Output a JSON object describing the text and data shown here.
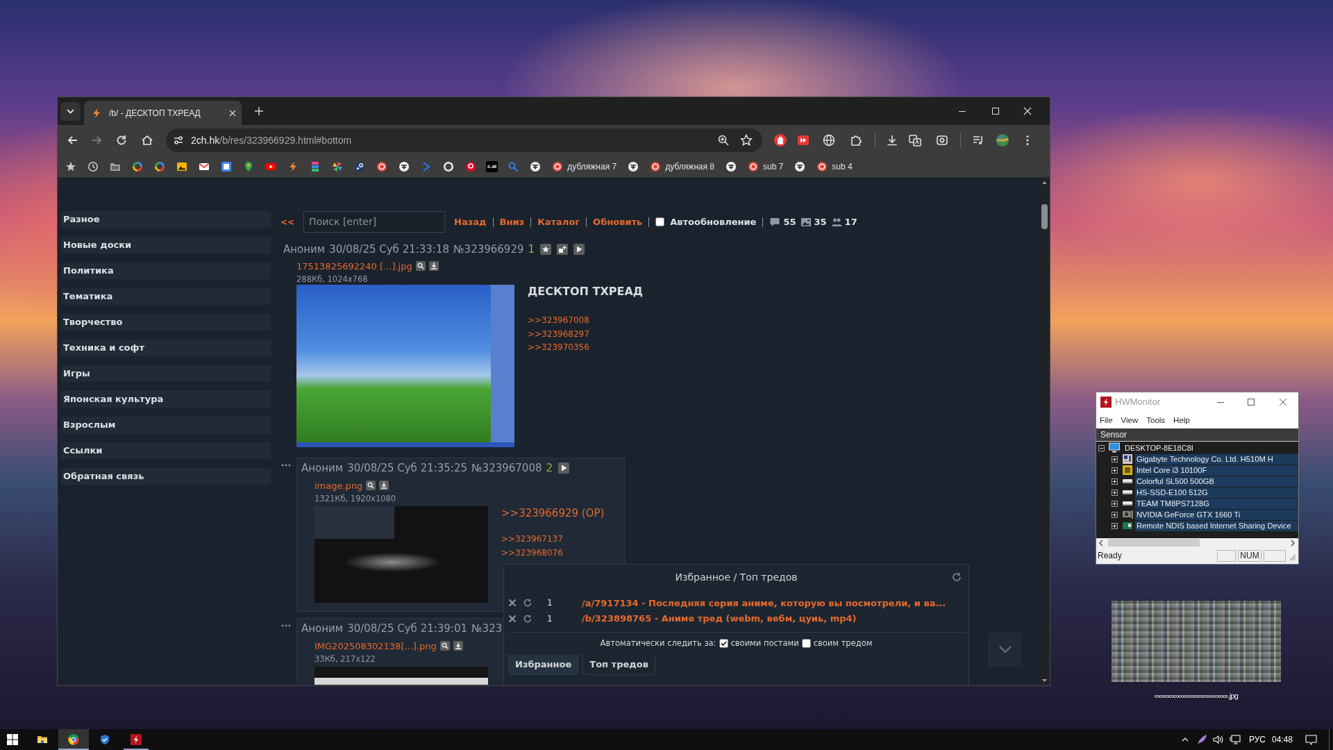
{
  "browser": {
    "tabs": [
      {
        "title": "/b/ - ДЕСКТОП ТХРЕАД",
        "selected": true
      }
    ],
    "forward": {
      "disabled": true
    },
    "url": {
      "host": "2ch.hk",
      "path": "/b/res/323966929.html#bottom"
    },
    "bookmarks": [
      {
        "kind": "tile",
        "label": "c.ai"
      },
      {
        "kind": "text",
        "label": "дубляжная 7"
      },
      {
        "kind": "text",
        "label": "дубляжная 8"
      },
      {
        "kind": "text",
        "label": "sub 7"
      },
      {
        "kind": "text",
        "label": "sub 4"
      }
    ]
  },
  "sidebar": {
    "items": [
      "Разное",
      "Новые доски",
      "Политика",
      "Тематика",
      "Творчество",
      "Техника и софт",
      "Игры",
      "Японская культура",
      "Взрослым",
      "Ссылки",
      "Обратная связь"
    ]
  },
  "thread_nav": {
    "back": "<<",
    "search": {
      "placeholder": "Поиск [enter]"
    },
    "links": [
      "Назад",
      "Вниз",
      "Каталог",
      "Обновить"
    ],
    "autoupdate": {
      "label": "Автообновление",
      "checked": false
    },
    "stats": {
      "posts": "55",
      "images": "35",
      "posters": "17"
    }
  },
  "posts": [
    {
      "kind": "op",
      "name": "Аноним",
      "date": "30/08/25 Суб 21:33:18",
      "number": "№323966929",
      "count": "1",
      "file": {
        "name": "17513825692240 [...].jpg",
        "info": "288Кб, 1024x768"
      },
      "subject": "ДЕСКТОП ТХРЕАД",
      "backlinks": [
        ">>323967008",
        ">>323968297",
        ">>323970356"
      ]
    },
    {
      "kind": "reply",
      "name": "Аноним",
      "date": "30/08/25 Суб 21:35:25",
      "number": "№323967008",
      "count": "2",
      "file": {
        "name": "image.png",
        "info": "1321Кб, 1920x1080"
      },
      "quote": ">>323966929 (OP)",
      "backlinks": [
        ">>323967137",
        ">>323968076"
      ]
    },
    {
      "kind": "reply",
      "name": "Аноним",
      "date": "30/08/25 Суб 21:39:01",
      "number": "№323",
      "file": {
        "name": "IMG202508302138[...].png",
        "info": "33Кб, 217x122"
      }
    }
  ],
  "favorites": {
    "title": "Избранное / Топ тредов",
    "threads": [
      {
        "count": "1",
        "link": "/a/7917134 - Последняя серия аниме, которую вы посмотрели, и ва..."
      },
      {
        "count": "1",
        "link": "/b/323898765 - Аниме тред (webm, вебм, цуиь, mp4)"
      }
    ],
    "autofollow": {
      "label": "Автоматически следить за:",
      "options": [
        {
          "label": "своими постами",
          "checked": true
        },
        {
          "label": "своим тредом",
          "checked": false
        }
      ]
    },
    "tabs": [
      {
        "label": "Избранное",
        "selected": true
      },
      {
        "label": "Топ тредов",
        "selected": false
      }
    ]
  },
  "hwmonitor": {
    "title": "HWMonitor",
    "menu": [
      "File",
      "View",
      "Tools",
      "Help"
    ],
    "column": "Sensor",
    "tree": [
      {
        "label": "DESKTOP-8E18C8I",
        "expanded": true,
        "selected": false,
        "children": [
          {
            "label": "Gigabyte Technology Co. Ltd. H510M H",
            "expanded": false,
            "selected": true
          },
          {
            "label": "Intel Core i3 10100F",
            "expanded": false,
            "selected": true
          },
          {
            "label": "Colorful SL500 500GB",
            "expanded": false,
            "selected": true
          },
          {
            "label": "HS-SSD-E100 512G",
            "expanded": false,
            "selected": true
          },
          {
            "label": "TEAM TM8PS7128G",
            "expanded": false,
            "selected": true
          },
          {
            "label": "NVIDIA GeForce GTX 1660 Ti",
            "expanded": false,
            "selected": true
          },
          {
            "label": "Remote NDIS based Internet Sharing Device",
            "expanded": false,
            "selected": true
          }
        ]
      }
    ],
    "status": "Ready",
    "indicator": "NUM"
  },
  "desktop_file": {
    "name": "∞∞∞∞∞∞∞∞∞∞∞∞∞∞∞.jpg"
  },
  "taskbar": {
    "apps": [
      {
        "active": false,
        "running": false
      },
      {
        "active": true,
        "running": true
      },
      {
        "active": false,
        "running": false
      },
      {
        "active": false,
        "running": true
      }
    ],
    "tray": {
      "language": "РУС",
      "time": "04:48"
    }
  }
}
